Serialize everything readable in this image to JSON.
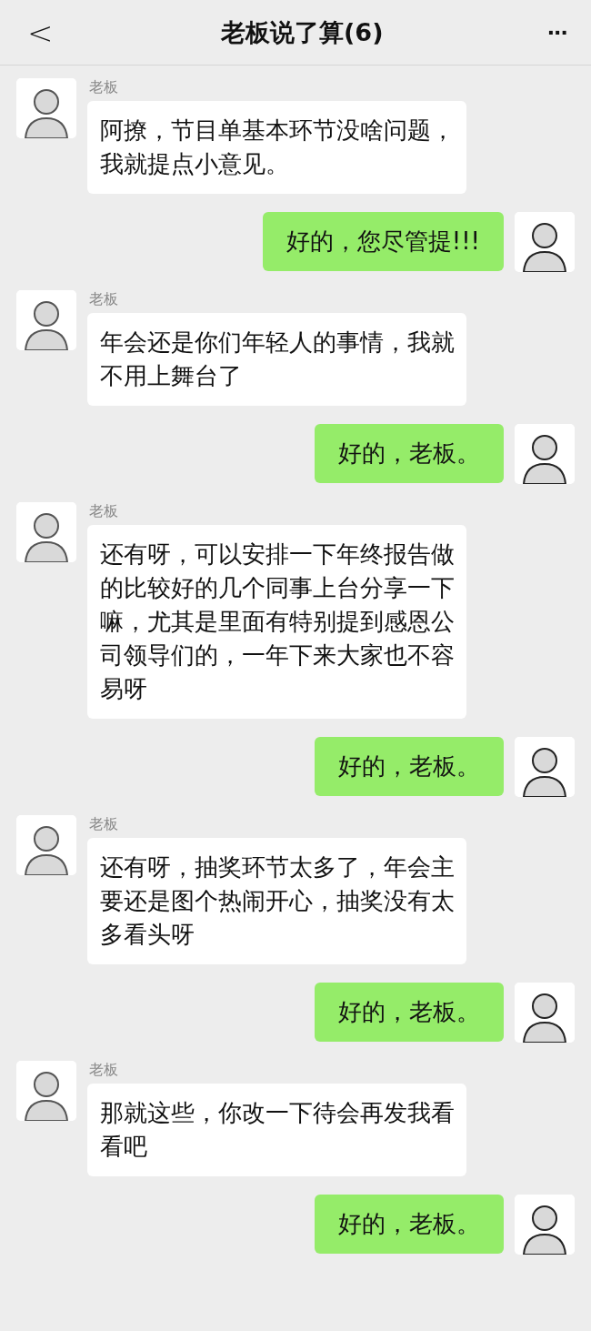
{
  "header": {
    "back": "<",
    "title": "老板说了算(6)",
    "more": "···"
  },
  "messages": [
    {
      "kind": "received",
      "sender": "老板",
      "text": "阿撩，节目单基本环节没啥问题，我就提点小意见。"
    },
    {
      "kind": "sent",
      "text": "好的，您尽管提!!!"
    },
    {
      "kind": "received",
      "sender": "老板",
      "text": "年会还是你们年轻人的事情，我就不用上舞台了"
    },
    {
      "kind": "sent",
      "text": "好的，老板。"
    },
    {
      "kind": "received",
      "sender": "老板",
      "text": "还有呀，可以安排一下年终报告做的比较好的几个同事上台分享一下嘛，尤其是里面有特别提到感恩公司领导们的，一年下来大家也不容易呀"
    },
    {
      "kind": "sent",
      "text": "好的，老板。"
    },
    {
      "kind": "received",
      "sender": "老板",
      "text": "还有呀，抽奖环节太多了，年会主要还是图个热闹开心，抽奖没有太多看头呀"
    },
    {
      "kind": "sent",
      "text": "好的，老板。"
    },
    {
      "kind": "received",
      "sender": "老板",
      "text": "那就这些，你改一下待会再发我看看吧"
    },
    {
      "kind": "sent",
      "text": "好的，老板。"
    }
  ]
}
